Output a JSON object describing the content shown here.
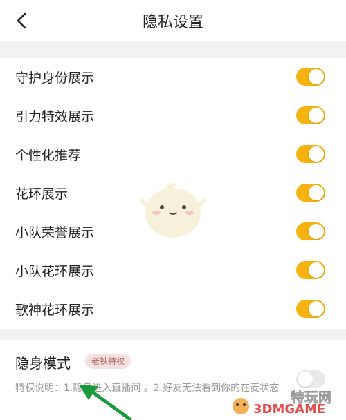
{
  "header": {
    "title": "隐私设置"
  },
  "settings": [
    {
      "label": "守护身份展示",
      "enabled": true
    },
    {
      "label": "引力特效展示",
      "enabled": true
    },
    {
      "label": "个性化推荐",
      "enabled": true
    },
    {
      "label": "花环展示",
      "enabled": true
    },
    {
      "label": "小队荣誉展示",
      "enabled": true
    },
    {
      "label": "小队花环展示",
      "enabled": true
    },
    {
      "label": "歌神花环展示",
      "enabled": true
    }
  ],
  "stealth": {
    "label": "隐身模式",
    "badge": "老铁特权",
    "description": "特权说明：1.隐身进入直播间 。2.好友无法看到你的在麦状态",
    "enabled": false
  },
  "watermark": {
    "text": "3DMGAME",
    "text2": "特玩网"
  },
  "colors": {
    "toggle_on": "#f5b311",
    "toggle_off": "#e9e9e9",
    "badge_bg": "#f6e1e1",
    "badge_text": "#b36a6a",
    "section_gap": "#f2f2f2",
    "arrow": "#1a9a3c"
  }
}
